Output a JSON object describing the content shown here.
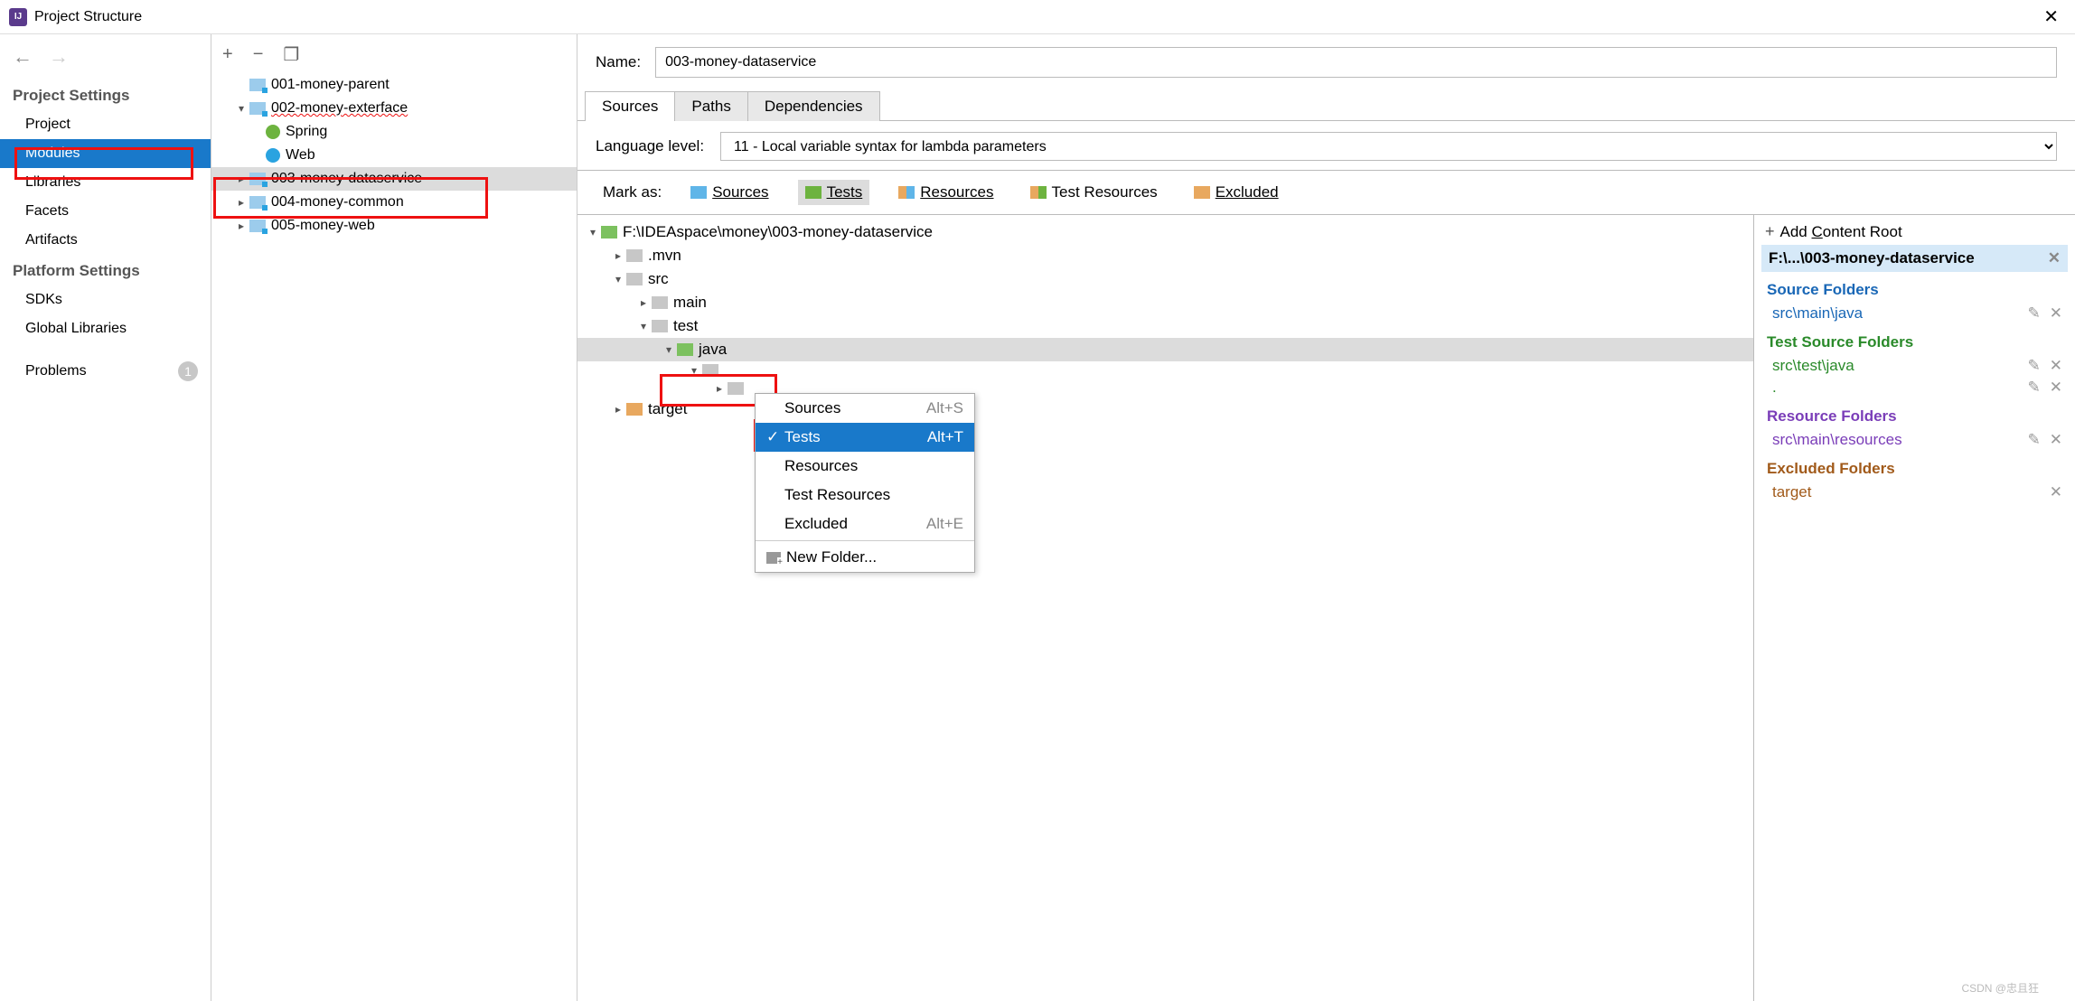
{
  "window": {
    "title": "Project Structure"
  },
  "nav": {
    "section1": "Project Settings",
    "items1": [
      "Project",
      "Modules",
      "Libraries",
      "Facets",
      "Artifacts"
    ],
    "section2": "Platform Settings",
    "items2": [
      "SDKs",
      "Global Libraries"
    ],
    "problems_label": "Problems",
    "problems_count": "1"
  },
  "moduleTree": {
    "items": [
      {
        "label": "001-money-parent"
      },
      {
        "label": "002-money-exterface",
        "squiggle": true
      },
      {
        "label": "Spring",
        "sub": true,
        "icon": "spring"
      },
      {
        "label": "Web",
        "sub": true,
        "icon": "web"
      },
      {
        "label": "003-money-dataservice",
        "selected": true
      },
      {
        "label": "004-money-common"
      },
      {
        "label": "005-money-web"
      }
    ]
  },
  "detail": {
    "name_label": "Name:",
    "name_value": "003-money-dataservice",
    "tabs": [
      "Sources",
      "Paths",
      "Dependencies"
    ],
    "lang_label": "Language level:",
    "lang_value": "11 - Local variable syntax for lambda parameters",
    "markas_label": "Mark as:",
    "markas": {
      "sources": "Sources",
      "tests": "Tests",
      "resources": "Resources",
      "testres": "Test Resources",
      "excluded": "Excluded"
    },
    "tree": {
      "root": "F:\\IDEAspace\\money\\003-money-dataservice",
      "mvn": ".mvn",
      "src": "src",
      "main": "main",
      "test": "test",
      "java": "java",
      "target": "target"
    },
    "context": {
      "sources": {
        "label": "Sources",
        "shortcut": "Alt+S"
      },
      "tests": {
        "label": "Tests",
        "shortcut": "Alt+T"
      },
      "resources": {
        "label": "Resources"
      },
      "testres": {
        "label": "Test Resources"
      },
      "excluded": {
        "label": "Excluded",
        "shortcut": "Alt+E"
      },
      "newfolder": "New Folder..."
    },
    "right": {
      "addroot": "Add Content Root",
      "rootpath": "F:\\...\\003-money-dataservice",
      "groups": {
        "source": {
          "title": "Source Folders",
          "paths": [
            "src\\main\\java"
          ]
        },
        "testsource": {
          "title": "Test Source Folders",
          "paths": [
            "src\\test\\java",
            "."
          ]
        },
        "resource": {
          "title": "Resource Folders",
          "paths": [
            "src\\main\\resources"
          ]
        },
        "excluded": {
          "title": "Excluded Folders",
          "paths": [
            "target"
          ]
        }
      }
    }
  },
  "watermark": "CSDN @忠且狂"
}
